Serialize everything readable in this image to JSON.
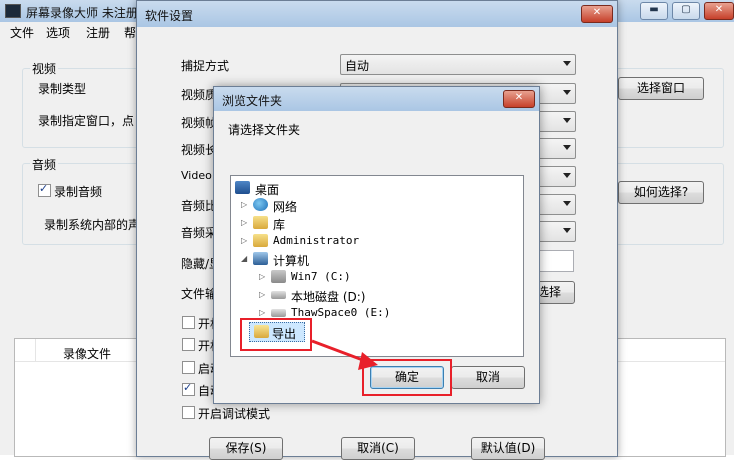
{
  "main_window": {
    "title": "屏幕录像大师 未注册",
    "menu": [
      "文件",
      "选项",
      "注册",
      "帮"
    ],
    "video_group_label": "视频",
    "record_type_label": "录制类型",
    "record_window_text": "录制指定窗口，点",
    "select_window_button": "选择窗口",
    "audio_group_label": "音频",
    "record_audio_label": "录制音频",
    "record_audio_checked": true,
    "record_system_sound_text": "录制系统内部的声",
    "how_select_button": "如何选择?",
    "video_file_header": "录像文件"
  },
  "settings_dialog": {
    "title": "软件设置",
    "capture_mode_label": "捕捉方式",
    "capture_mode_value": "自动",
    "row_labels": [
      "视频质",
      "视频帧",
      "视频长",
      "Video G",
      "音频比",
      "音频采",
      "隐藏/显",
      "文件输"
    ],
    "checkboxes": [
      {
        "label": "开机",
        "checked": false
      },
      {
        "label": "开机",
        "checked": false
      },
      {
        "label": "启动",
        "checked": false
      },
      {
        "label": "自动",
        "checked": true
      },
      {
        "label": "开启调试模式",
        "checked": false
      }
    ],
    "choose_button": "选择",
    "save_button": "保存(S)",
    "cancel_button": "取消(C)",
    "default_button": "默认值(D)"
  },
  "browse_dialog": {
    "title": "浏览文件夹",
    "prompt": "请选择文件夹",
    "tree": [
      {
        "label": "桌面",
        "icon": "desktop-icon",
        "level": 0,
        "expander": ""
      },
      {
        "label": "网络",
        "icon": "network-icon",
        "level": 1,
        "expander": "▷"
      },
      {
        "label": "库",
        "icon": "library-icon",
        "level": 1,
        "expander": "▷"
      },
      {
        "label": "Administrator",
        "icon": "user-folder-icon",
        "level": 1,
        "expander": "▷"
      },
      {
        "label": "计算机",
        "icon": "computer-icon",
        "level": 1,
        "expander": "◢"
      },
      {
        "label": "Win7 (C:)",
        "icon": "system-drive-icon",
        "level": 2,
        "expander": "▷"
      },
      {
        "label": "本地磁盘 (D:)",
        "icon": "drive-icon",
        "level": 2,
        "expander": "▷"
      },
      {
        "label": "ThawSpace0 (E:)",
        "icon": "drive-icon",
        "level": 2,
        "expander": "▷"
      },
      {
        "label": "导出",
        "icon": "folder-icon",
        "level": 1,
        "expander": "",
        "selected": true
      }
    ],
    "ok_button": "确定",
    "cancel_button": "取消"
  },
  "annotation_color": "#e8202a"
}
